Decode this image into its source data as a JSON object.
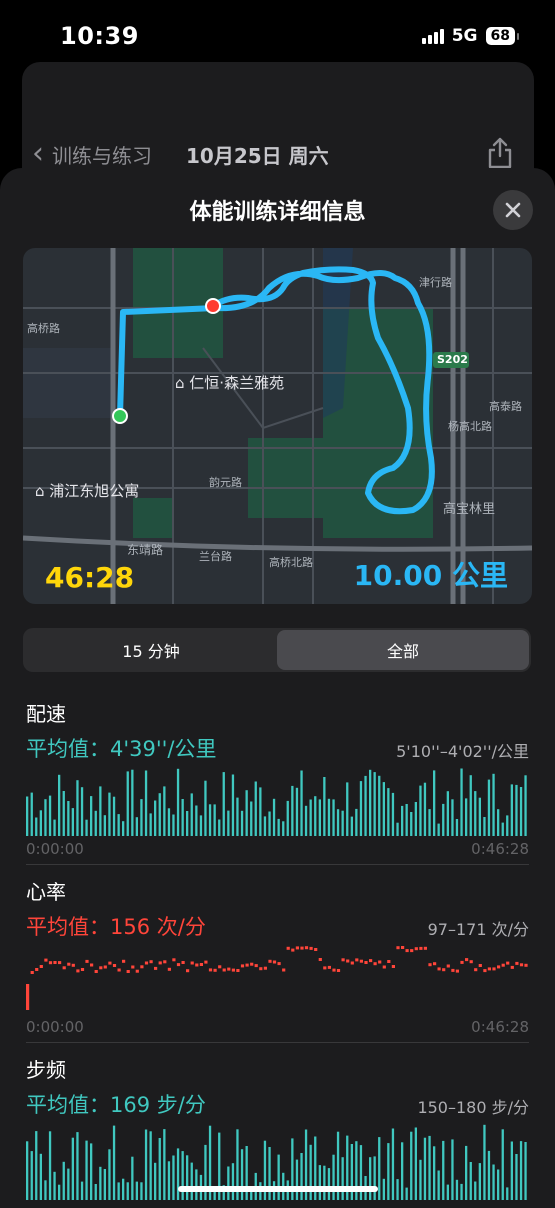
{
  "status_bar": {
    "time": "10:39",
    "network": "5G",
    "battery": "68"
  },
  "background_nav": {
    "back_label": "训练与练习",
    "date": "10月25日 周六"
  },
  "sheet": {
    "title": "体能训练详细信息"
  },
  "map": {
    "duration": "46:28",
    "distance": "10.00 公里",
    "labels": {
      "poi_1": "仁恒·森兰雅苑",
      "poi_2": "浦江东旭公寓",
      "road_1": "韵元路",
      "road_2": "东靖路",
      "road_3": "兰台路",
      "road_4": "高桥北路",
      "road_5": "杨高北路",
      "road_6": "S202",
      "road_7": "高宝林里",
      "road_8": "高泰路",
      "road_9": "津行路",
      "road_10": "高桥路"
    },
    "route_color": "#2ab7f5",
    "start_color": "#34c759",
    "end_color": "#ff3b30"
  },
  "segments": {
    "option_1": "15 分钟",
    "option_2": "全部",
    "selected": "全部"
  },
  "pace": {
    "title": "配速",
    "average": "平均值：4'39''/公里",
    "range": "5'10''–4'02''/公里",
    "start": "0:00:00",
    "end": "0:46:28",
    "color": "#40c8c0"
  },
  "heart_rate": {
    "title": "心率",
    "average": "平均值：156 次/分",
    "range": "97–171 次/分",
    "start": "0:00:00",
    "end": "0:46:28",
    "color": "#ff453a"
  },
  "cadence": {
    "title": "步频",
    "average": "平均值：169 步/分",
    "range": "150–180 步/分",
    "color": "#40c8c0"
  }
}
